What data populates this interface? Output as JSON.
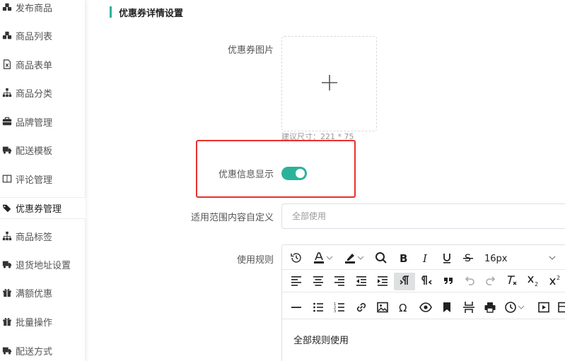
{
  "sidebar": {
    "items": [
      {
        "label": "发布商品",
        "icon": "cubes-icon"
      },
      {
        "label": "商品列表",
        "icon": "cubes-icon"
      },
      {
        "label": "商品表单",
        "icon": "spreadsheet-icon"
      },
      {
        "label": "商品分类",
        "icon": "sitemap-icon"
      },
      {
        "label": "品牌管理",
        "icon": "briefcase-icon"
      },
      {
        "label": "配送模板",
        "icon": "truck-icon"
      },
      {
        "label": "评论管理",
        "icon": "columns-icon"
      },
      {
        "label": "优惠券管理",
        "icon": "tags-icon",
        "active": true
      },
      {
        "label": "商品标签",
        "icon": "sitemap-icon"
      },
      {
        "label": "退货地址设置",
        "icon": "truck-icon"
      },
      {
        "label": "满额优惠",
        "icon": "gift-icon"
      },
      {
        "label": "批量操作",
        "icon": "gift-icon"
      },
      {
        "label": "配送方式",
        "icon": "truck-icon"
      }
    ]
  },
  "section": {
    "title": "优惠券详情设置"
  },
  "form": {
    "image_label": "优惠券图片",
    "image_hint": "建议尺寸：221 * 75",
    "display_label": "优惠信息显示",
    "display_enabled": true,
    "scope_label": "适用范围内容自定义",
    "scope_placeholder": "全部使用",
    "rules_label": "使用规则"
  },
  "editor": {
    "font_size": "16px",
    "content": "全部规则使用"
  },
  "colors": {
    "accent": "#2bb39a",
    "highlight": "#e8312a"
  }
}
